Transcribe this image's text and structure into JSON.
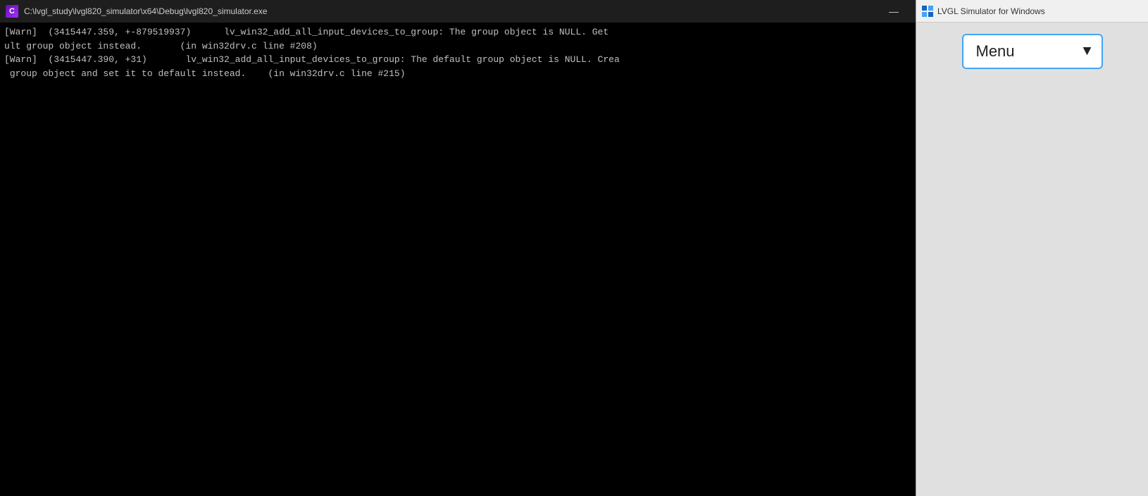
{
  "console": {
    "titlebar": {
      "icon_letter": "C",
      "title": "C:\\lvgl_study\\lvgl820_simulator\\x64\\Debug\\lvgl820_simulator.exe",
      "minimize_btn": "—"
    },
    "lines": [
      "[Warn]  (3415447.359, +-879519937)      lv_win32_add_all_input_devices_to_group: The group object is NULL. Get",
      "ult group object instead.       (in win32drv.c line #208)",
      "[Warn]  (3415447.390, +31)       lv_win32_add_all_input_devices_to_group: The default group object is NULL. Crea",
      " group object and set it to default instead.    (in win32drv.c line #215)"
    ]
  },
  "simulator": {
    "titlebar": {
      "title": "LVGL Simulator for Windows"
    },
    "menu": {
      "label": "Menu",
      "arrow": "▼"
    }
  }
}
